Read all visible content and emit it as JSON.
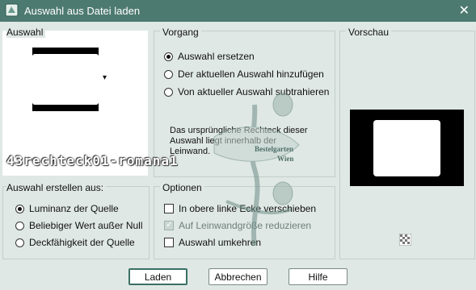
{
  "window": {
    "title": "Auswahl aus Datei laden",
    "close_glyph": "✕"
  },
  "auswahl": {
    "label": "Auswahl",
    "dropdown_arrow": "▾"
  },
  "vorgang": {
    "label": "Vorgang",
    "options": [
      {
        "label": "Auswahl ersetzen",
        "selected": true
      },
      {
        "label": "Der aktuellen Auswahl hinzufügen",
        "selected": false
      },
      {
        "label": "Von aktueller Auswahl subtrahieren",
        "selected": false
      }
    ],
    "info_lines": [
      "Das ursprüngliche Rechteck dieser",
      "Auswahl liegt innerhalb der",
      "Leinwand."
    ]
  },
  "vorschau": {
    "label": "Vorschau",
    "preview_bg": "#000000",
    "preview_fg": "#ffffff"
  },
  "quelle": {
    "label": "Auswahl erstellen aus:",
    "options": [
      {
        "label": "Luminanz der Quelle",
        "selected": true
      },
      {
        "label": "Beliebiger Wert außer Null",
        "selected": false
      },
      {
        "label": "Deckfähigkeit der Quelle",
        "selected": false
      }
    ]
  },
  "optionen": {
    "label": "Optionen",
    "checks": [
      {
        "label": "In obere linke Ecke verschieben",
        "checked": false,
        "disabled": false
      },
      {
        "label": "Auf Leinwandgröße reduzieren",
        "checked": true,
        "disabled": true
      },
      {
        "label": "Auswahl umkehren",
        "checked": false,
        "disabled": false
      }
    ]
  },
  "buttons": {
    "load": "Laden",
    "cancel": "Abbrechen",
    "help": "Hilfe"
  },
  "watermark": {
    "text": "43rechteck01-romana1",
    "stamp_line1": "Bestelgarten",
    "stamp_line2": "Wien"
  },
  "colors": {
    "titlebar": "#4d7a70",
    "panel": "#dfe8e4"
  }
}
